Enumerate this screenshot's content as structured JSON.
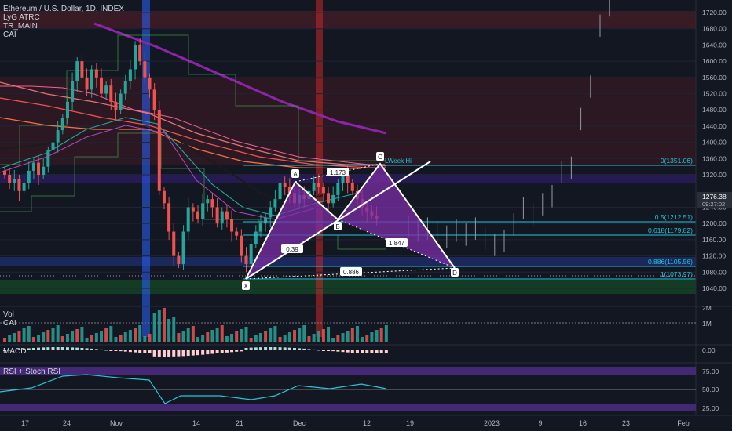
{
  "header": {
    "symbol_line": "Ethereum / U.S. Dollar, 1D, INDEX",
    "indicators": [
      "LyG ATRC",
      "TR_MAIN",
      "CAI"
    ]
  },
  "price_axis": {
    "ticks": [
      "1720.00",
      "1680.00",
      "1640.00",
      "1600.00",
      "1560.00",
      "1520.00",
      "1480.00",
      "1440.00",
      "1400.00",
      "1360.00",
      "1320.00",
      "1240.00",
      "1200.00",
      "1160.00",
      "1120.00",
      "1080.00",
      "1040.00"
    ],
    "current_price": "1276.38",
    "countdown": "09:27:02"
  },
  "time_axis": {
    "labels": [
      "17",
      "24",
      "Nov",
      "14",
      "21",
      "Dec",
      "12",
      "19",
      "2023",
      "9",
      "16",
      "23",
      "Feb"
    ]
  },
  "levels": [
    {
      "label": "0(1351.06)",
      "color": "#26c6da"
    },
    {
      "label": "0.5(1212.51)",
      "color": "#26c6da"
    },
    {
      "label": "0.618(1179.82)",
      "color": "#26c6da"
    },
    {
      "label": "0.886(1105.56)",
      "color": "#26c6da"
    },
    {
      "label": "1(1073.97)",
      "color": "#26c6da"
    }
  ],
  "pattern": {
    "points": [
      "X",
      "A",
      "B",
      "C",
      "D"
    ],
    "ratios": [
      "1.173",
      "0.39",
      "1.847",
      "0.886"
    ],
    "note": "LWeek Hi"
  },
  "panes": {
    "volume": {
      "title": "Vol",
      "sub": "CAI",
      "ticks": [
        "2M",
        "1M"
      ]
    },
    "macd": {
      "title": "MACD",
      "ticks": [
        "0.00"
      ]
    },
    "rsi": {
      "title": "RSI + Stoch RSI",
      "ticks": [
        "75.00",
        "50.00",
        "25.00"
      ]
    }
  },
  "colors": {
    "background": "#131722",
    "up": "#26a69a",
    "down": "#ef5350",
    "pattern_fill": "#7b2fa6",
    "fib_line": "#26c6da"
  }
}
